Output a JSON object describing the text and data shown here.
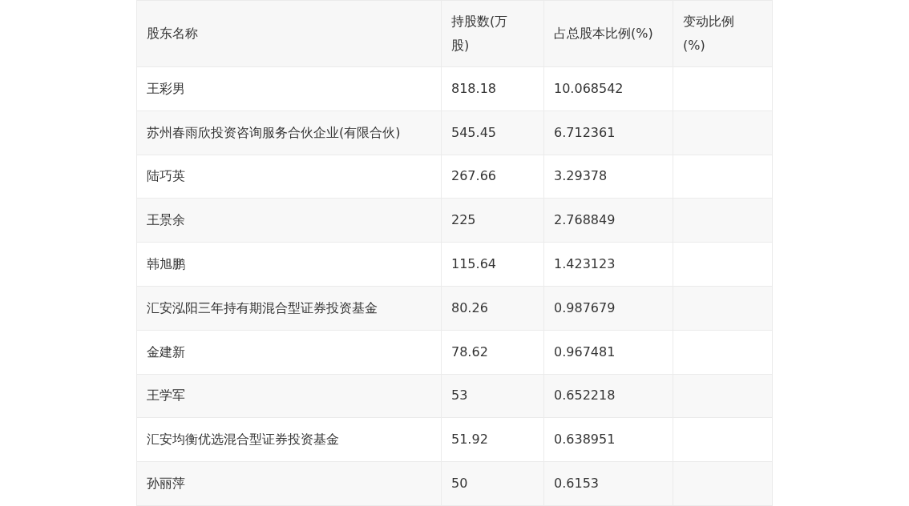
{
  "table": {
    "columns": [
      "股东名称",
      "持股数(万股)",
      "占总股本比例(%)",
      "变动比例(%)"
    ],
    "rows": [
      [
        "王彩男",
        "818.18",
        "10.068542"
      ],
      [
        "苏州春雨欣投资咨询服务合伙企业(有限合伙)",
        "545.45",
        "6.712361"
      ],
      [
        "陆巧英",
        "267.66",
        "3.29378"
      ],
      [
        "王景余",
        "225",
        "2.768849"
      ],
      [
        "韩旭鹏",
        "115.64",
        "1.423123"
      ],
      [
        "汇安泓阳三年持有期混合型证券投资基金",
        "80.26",
        "0.987679"
      ],
      [
        "金建新",
        "78.62",
        "0.967481"
      ],
      [
        "王学军",
        "53",
        "0.652218"
      ],
      [
        "汇安均衡优选混合型证券投资基金",
        "51.92",
        "0.638951"
      ],
      [
        "孙丽萍",
        "50",
        "0.6153"
      ]
    ]
  }
}
